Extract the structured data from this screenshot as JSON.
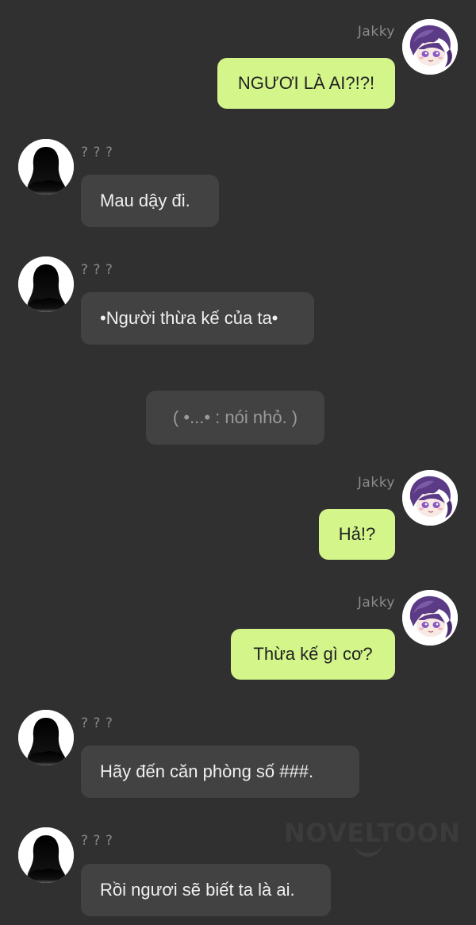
{
  "chat": {
    "messages": [
      {
        "sender": "Jakky",
        "text": "NGƯƠI LÀ AI?!?!"
      },
      {
        "sender": "? ? ?",
        "text": "Mau dậy đi."
      },
      {
        "sender": "? ? ?",
        "text": "•Người thừa kế của ta•"
      },
      {
        "sender": "",
        "text": "( •...• : nói nhỏ. )"
      },
      {
        "sender": "Jakky",
        "text": "Hả!?"
      },
      {
        "sender": "Jakky",
        "text": "Thừa kế gì cơ?"
      },
      {
        "sender": "? ? ?",
        "text": "Hãy đến căn phòng số ###."
      },
      {
        "sender": "? ? ?",
        "text": "Rồi ngươi sẽ biết ta là ai."
      }
    ]
  },
  "watermark": {
    "text": "NOVELTOON"
  },
  "colors": {
    "background": "#303030",
    "my_bubble": "#d3f58a",
    "their_bubble": "#424242",
    "name_text": "#8a8a8a"
  },
  "icons": {
    "me_avatar": "anime-boy-avatar-icon",
    "them_avatar": "silhouette-avatar-icon"
  }
}
